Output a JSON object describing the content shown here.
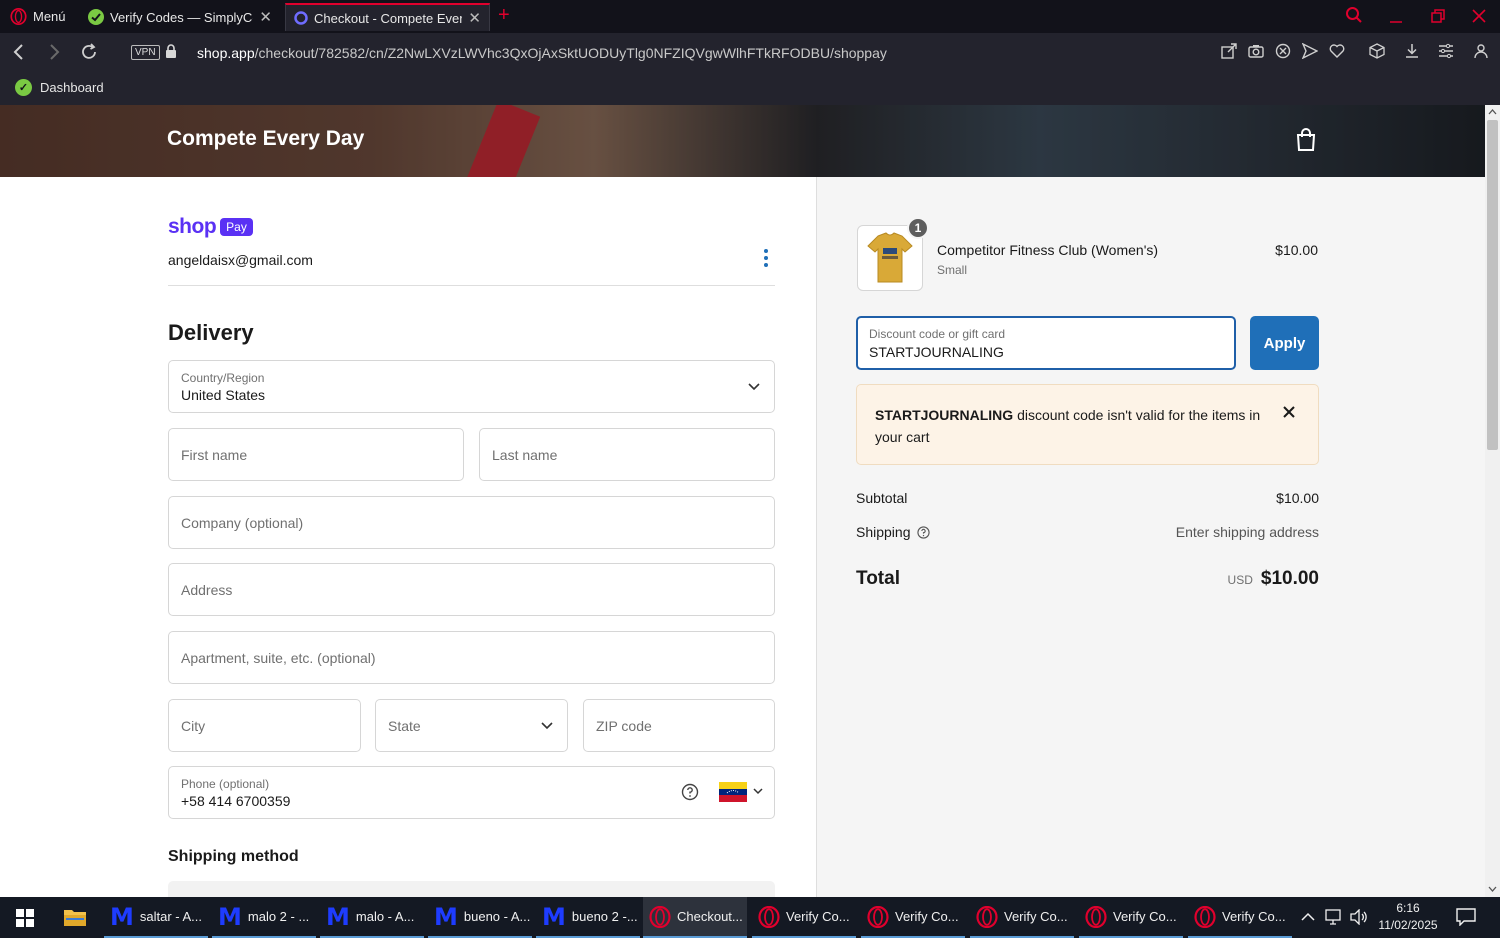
{
  "browser": {
    "menu_label": "Menú",
    "tabs": [
      {
        "label": "Verify Codes — SimplyCodes"
      },
      {
        "label": "Checkout - Compete Every Day"
      }
    ],
    "url_host": "shop.app",
    "url_path": "/checkout/782582/cn/Z2NwLXVzLWVhc3QxOjAxSktUODUyTlg0NFZIQVgwWlhFTkRFODBU/shoppay",
    "vpn_label": "VPN",
    "bookmarks": [
      {
        "label": "Dashboard"
      }
    ]
  },
  "store": {
    "name": "Compete Every Day"
  },
  "shop_pay": {
    "word": "shop",
    "badge": "Pay",
    "email": "angeldaisx@gmail.com"
  },
  "delivery": {
    "heading": "Delivery",
    "country": {
      "label": "Country/Region",
      "value": "United States"
    },
    "first_name": {
      "placeholder": "First name"
    },
    "last_name": {
      "placeholder": "Last name"
    },
    "company": {
      "placeholder": "Company (optional)"
    },
    "address": {
      "placeholder": "Address"
    },
    "apartment": {
      "placeholder": "Apartment, suite, etc. (optional)"
    },
    "city": {
      "placeholder": "City"
    },
    "state": {
      "placeholder": "State"
    },
    "zip": {
      "placeholder": "ZIP code"
    },
    "phone": {
      "label": "Phone (optional)",
      "value": "+58 414 6700359"
    }
  },
  "shipping_method": {
    "heading": "Shipping method"
  },
  "summary": {
    "item": {
      "quantity": "1",
      "name": "Competitor Fitness Club (Women's)",
      "variant": "Small",
      "price": "$10.00"
    },
    "discount": {
      "label": "Discount code or gift card",
      "value": "STARTJOURNALING",
      "apply_label": "Apply"
    },
    "error": {
      "code": "STARTJOURNALING",
      "message": " discount code isn't valid for the items in your cart"
    },
    "subtotal": {
      "label": "Subtotal",
      "value": "$10.00"
    },
    "shipping": {
      "label": "Shipping",
      "value": "Enter shipping address"
    },
    "total": {
      "label": "Total",
      "currency": "USD",
      "value": "$10.00"
    }
  },
  "taskbar": {
    "items": [
      {
        "label": "saltar - A...",
        "icon": "m-icon"
      },
      {
        "label": "malo 2 - ...",
        "icon": "m-icon"
      },
      {
        "label": "malo - A...",
        "icon": "m-icon"
      },
      {
        "label": "bueno - A...",
        "icon": "m-icon"
      },
      {
        "label": "bueno 2 -...",
        "icon": "m-icon"
      },
      {
        "label": "Checkout...",
        "icon": "opera-icon"
      },
      {
        "label": "Verify Co...",
        "icon": "opera-icon"
      },
      {
        "label": "Verify Co...",
        "icon": "opera-icon"
      },
      {
        "label": "Verify Co...",
        "icon": "opera-icon"
      },
      {
        "label": "Verify Co...",
        "icon": "opera-icon"
      },
      {
        "label": "Verify Co...",
        "icon": "opera-icon"
      }
    ],
    "time": "6:16",
    "date": "11/02/2025"
  },
  "colors": {
    "accent": "#1f6fb8",
    "shop_purple": "#5a31f4",
    "opera_red": "#e0002d",
    "alert_bg": "#fdf3e7"
  }
}
